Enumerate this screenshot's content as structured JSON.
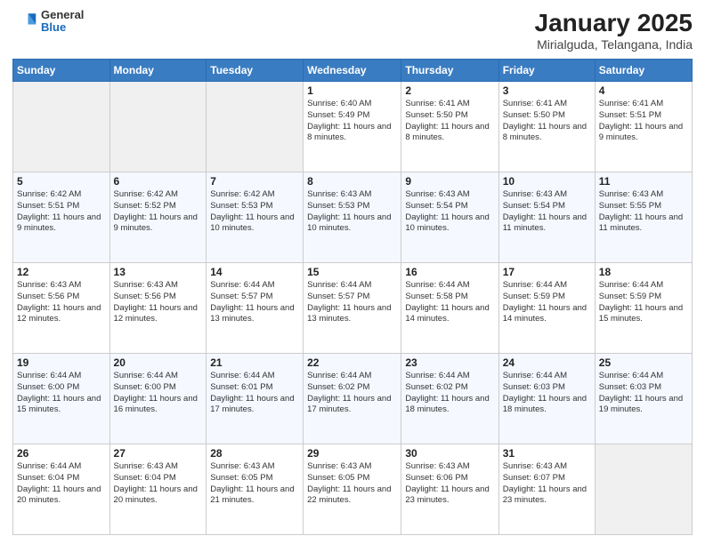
{
  "logo": {
    "general": "General",
    "blue": "Blue"
  },
  "title": "January 2025",
  "subtitle": "Mirialguda, Telangana, India",
  "weekdays": [
    "Sunday",
    "Monday",
    "Tuesday",
    "Wednesday",
    "Thursday",
    "Friday",
    "Saturday"
  ],
  "weeks": [
    [
      {
        "day": "",
        "info": ""
      },
      {
        "day": "",
        "info": ""
      },
      {
        "day": "",
        "info": ""
      },
      {
        "day": "1",
        "info": "Sunrise: 6:40 AM\nSunset: 5:49 PM\nDaylight: 11 hours and 8 minutes."
      },
      {
        "day": "2",
        "info": "Sunrise: 6:41 AM\nSunset: 5:50 PM\nDaylight: 11 hours and 8 minutes."
      },
      {
        "day": "3",
        "info": "Sunrise: 6:41 AM\nSunset: 5:50 PM\nDaylight: 11 hours and 8 minutes."
      },
      {
        "day": "4",
        "info": "Sunrise: 6:41 AM\nSunset: 5:51 PM\nDaylight: 11 hours and 9 minutes."
      }
    ],
    [
      {
        "day": "5",
        "info": "Sunrise: 6:42 AM\nSunset: 5:51 PM\nDaylight: 11 hours and 9 minutes."
      },
      {
        "day": "6",
        "info": "Sunrise: 6:42 AM\nSunset: 5:52 PM\nDaylight: 11 hours and 9 minutes."
      },
      {
        "day": "7",
        "info": "Sunrise: 6:42 AM\nSunset: 5:53 PM\nDaylight: 11 hours and 10 minutes."
      },
      {
        "day": "8",
        "info": "Sunrise: 6:43 AM\nSunset: 5:53 PM\nDaylight: 11 hours and 10 minutes."
      },
      {
        "day": "9",
        "info": "Sunrise: 6:43 AM\nSunset: 5:54 PM\nDaylight: 11 hours and 10 minutes."
      },
      {
        "day": "10",
        "info": "Sunrise: 6:43 AM\nSunset: 5:54 PM\nDaylight: 11 hours and 11 minutes."
      },
      {
        "day": "11",
        "info": "Sunrise: 6:43 AM\nSunset: 5:55 PM\nDaylight: 11 hours and 11 minutes."
      }
    ],
    [
      {
        "day": "12",
        "info": "Sunrise: 6:43 AM\nSunset: 5:56 PM\nDaylight: 11 hours and 12 minutes."
      },
      {
        "day": "13",
        "info": "Sunrise: 6:43 AM\nSunset: 5:56 PM\nDaylight: 11 hours and 12 minutes."
      },
      {
        "day": "14",
        "info": "Sunrise: 6:44 AM\nSunset: 5:57 PM\nDaylight: 11 hours and 13 minutes."
      },
      {
        "day": "15",
        "info": "Sunrise: 6:44 AM\nSunset: 5:57 PM\nDaylight: 11 hours and 13 minutes."
      },
      {
        "day": "16",
        "info": "Sunrise: 6:44 AM\nSunset: 5:58 PM\nDaylight: 11 hours and 14 minutes."
      },
      {
        "day": "17",
        "info": "Sunrise: 6:44 AM\nSunset: 5:59 PM\nDaylight: 11 hours and 14 minutes."
      },
      {
        "day": "18",
        "info": "Sunrise: 6:44 AM\nSunset: 5:59 PM\nDaylight: 11 hours and 15 minutes."
      }
    ],
    [
      {
        "day": "19",
        "info": "Sunrise: 6:44 AM\nSunset: 6:00 PM\nDaylight: 11 hours and 15 minutes."
      },
      {
        "day": "20",
        "info": "Sunrise: 6:44 AM\nSunset: 6:00 PM\nDaylight: 11 hours and 16 minutes."
      },
      {
        "day": "21",
        "info": "Sunrise: 6:44 AM\nSunset: 6:01 PM\nDaylight: 11 hours and 17 minutes."
      },
      {
        "day": "22",
        "info": "Sunrise: 6:44 AM\nSunset: 6:02 PM\nDaylight: 11 hours and 17 minutes."
      },
      {
        "day": "23",
        "info": "Sunrise: 6:44 AM\nSunset: 6:02 PM\nDaylight: 11 hours and 18 minutes."
      },
      {
        "day": "24",
        "info": "Sunrise: 6:44 AM\nSunset: 6:03 PM\nDaylight: 11 hours and 18 minutes."
      },
      {
        "day": "25",
        "info": "Sunrise: 6:44 AM\nSunset: 6:03 PM\nDaylight: 11 hours and 19 minutes."
      }
    ],
    [
      {
        "day": "26",
        "info": "Sunrise: 6:44 AM\nSunset: 6:04 PM\nDaylight: 11 hours and 20 minutes."
      },
      {
        "day": "27",
        "info": "Sunrise: 6:43 AM\nSunset: 6:04 PM\nDaylight: 11 hours and 20 minutes."
      },
      {
        "day": "28",
        "info": "Sunrise: 6:43 AM\nSunset: 6:05 PM\nDaylight: 11 hours and 21 minutes."
      },
      {
        "day": "29",
        "info": "Sunrise: 6:43 AM\nSunset: 6:05 PM\nDaylight: 11 hours and 22 minutes."
      },
      {
        "day": "30",
        "info": "Sunrise: 6:43 AM\nSunset: 6:06 PM\nDaylight: 11 hours and 23 minutes."
      },
      {
        "day": "31",
        "info": "Sunrise: 6:43 AM\nSunset: 6:07 PM\nDaylight: 11 hours and 23 minutes."
      },
      {
        "day": "",
        "info": ""
      }
    ]
  ]
}
